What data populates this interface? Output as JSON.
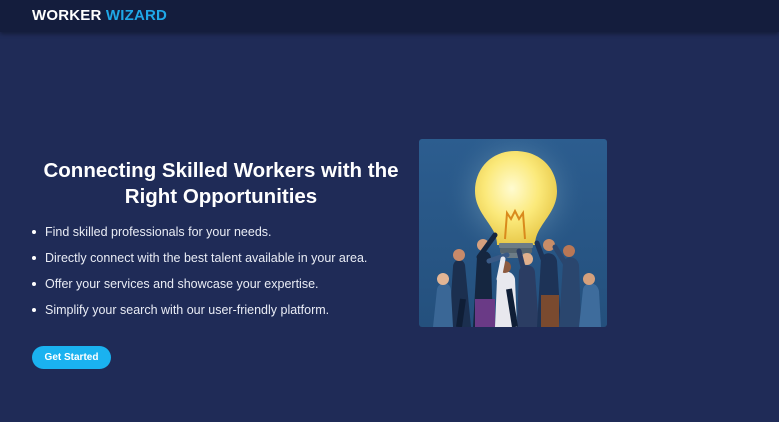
{
  "header": {
    "brand_main": "WORKER",
    "brand_accent": "WIZARD"
  },
  "hero": {
    "title": "Connecting Skilled Workers with the Right Opportunities",
    "features": [
      "Find skilled professionals for your needs.",
      "Directly connect with the best talent available in your area.",
      "Offer your services and showcase your expertise.",
      "Simplify your search with our user-friendly platform."
    ],
    "cta_label": "Get Started",
    "illustration_icon": "lightbulb-crowd-illustration"
  },
  "colors": {
    "page_bg": "#1f2b57",
    "navbar_bg": "#141d3d",
    "accent": "#1fa8e8",
    "button": "#1ab2f0"
  }
}
